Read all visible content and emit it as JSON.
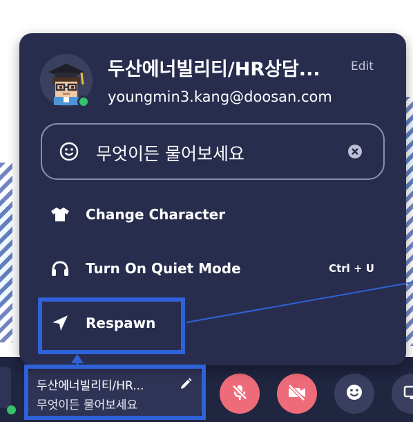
{
  "profile": {
    "name": "두산에너빌리티/HR상담...",
    "edit_label": "Edit",
    "email": "youngmin3.kang@doosan.com",
    "status_placeholder": "무엇이든 물어보세요"
  },
  "menu": {
    "items": [
      {
        "label": "Change Character",
        "icon": "tshirt-icon"
      },
      {
        "label": "Turn On Quiet Mode",
        "icon": "headphones-icon",
        "shortcut": "Ctrl + U"
      },
      {
        "label": "Respawn",
        "icon": "location-arrow-icon"
      }
    ]
  },
  "bottom_bar": {
    "chip_name": "두산에너빌리티/HR...",
    "chip_status": "무엇이든 물어보세요"
  },
  "colors": {
    "popup_bg": "#282d4e",
    "bottom_bar_bg": "#202540",
    "highlight": "#2f62d8",
    "mute_red": "#ee6c7a",
    "online_green": "#36c26a"
  }
}
